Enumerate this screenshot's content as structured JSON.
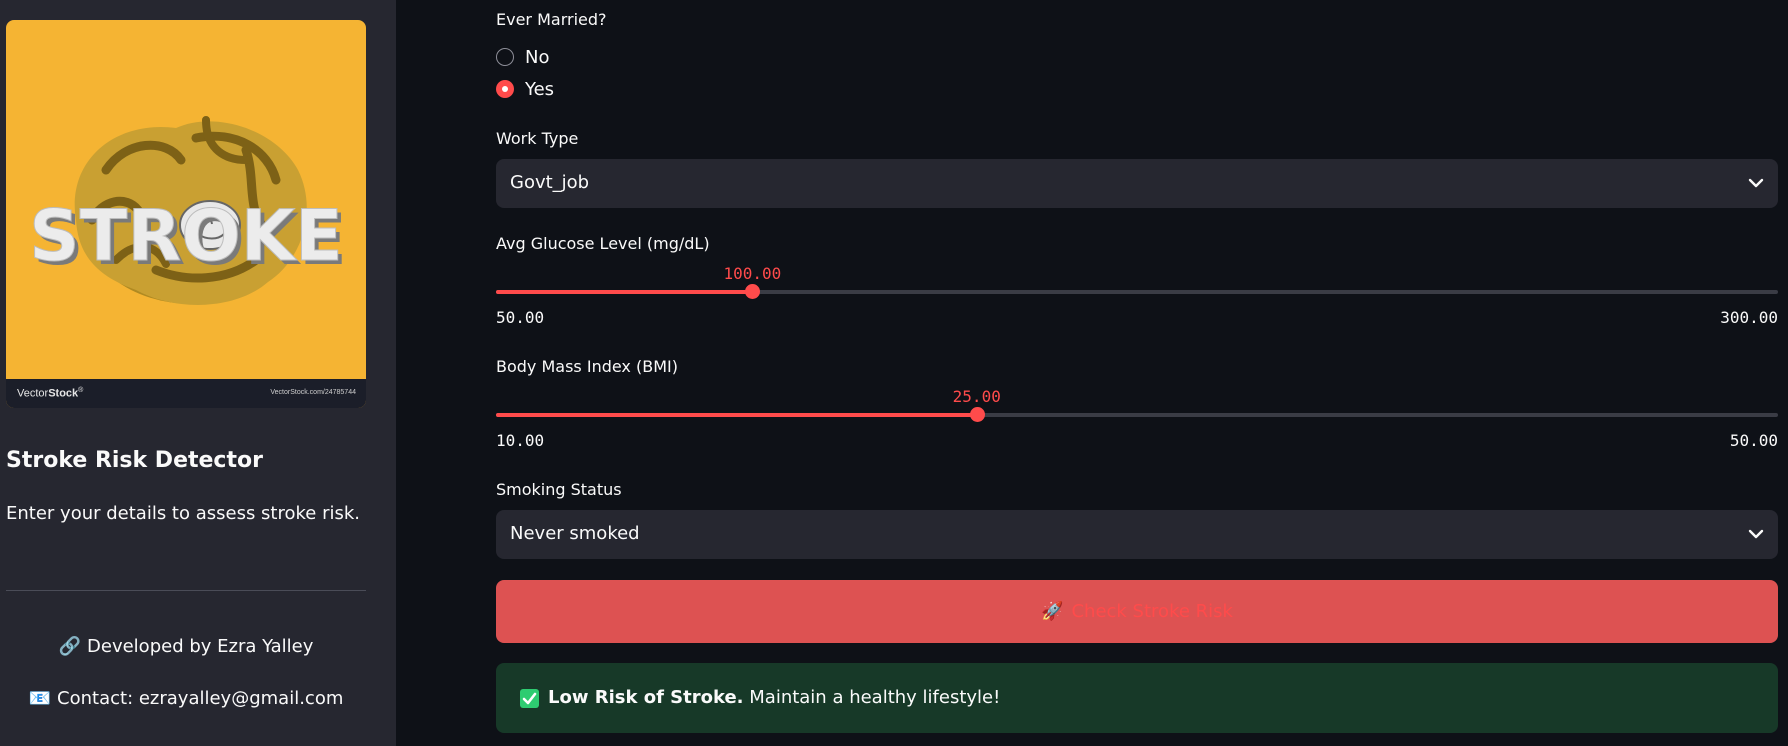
{
  "sidebar": {
    "logo": {
      "word": "STROKE",
      "brand_prefix": "Vector",
      "brand_suffix": "Stock",
      "brand_mark": "®",
      "url": "VectorStock.com/24785744"
    },
    "title": "Stroke Risk Detector",
    "description": "Enter your details to assess stroke risk.",
    "developer_icon": "link-icon",
    "developer": "🔗",
    "developer_text": "Developed by Ezra Yalley",
    "contact_emoji": "📧",
    "contact_text": "Contact: ezrayalley@gmail.com"
  },
  "form": {
    "ever_married": {
      "label": "Ever Married?",
      "options": [
        "No",
        "Yes"
      ],
      "selected": "Yes"
    },
    "work_type": {
      "label": "Work Type",
      "value": "Govt_job"
    },
    "glucose": {
      "label": "Avg Glucose Level (mg/dL)",
      "value_text": "100.00",
      "min_text": "50.00",
      "max_text": "300.00",
      "value": 100,
      "min": 50,
      "max": 300
    },
    "bmi": {
      "label": "Body Mass Index (BMI)",
      "value_text": "25.00",
      "min_text": "10.00",
      "max_text": "50.00",
      "value": 25,
      "min": 10,
      "max": 50
    },
    "smoking": {
      "label": "Smoking Status",
      "value": "Never smoked"
    }
  },
  "button": {
    "emoji": "🚀",
    "label": "Check Stroke Risk"
  },
  "result": {
    "icon": "check-icon",
    "bold": "Low Risk of Stroke.",
    "text": " Maintain a healthy lifestyle!"
  },
  "colors": {
    "accent": "#ff4b4b",
    "background": "#0e1117",
    "sidebar": "#262730",
    "success_bg": "#173928",
    "logo_bg": "#f5b433"
  }
}
